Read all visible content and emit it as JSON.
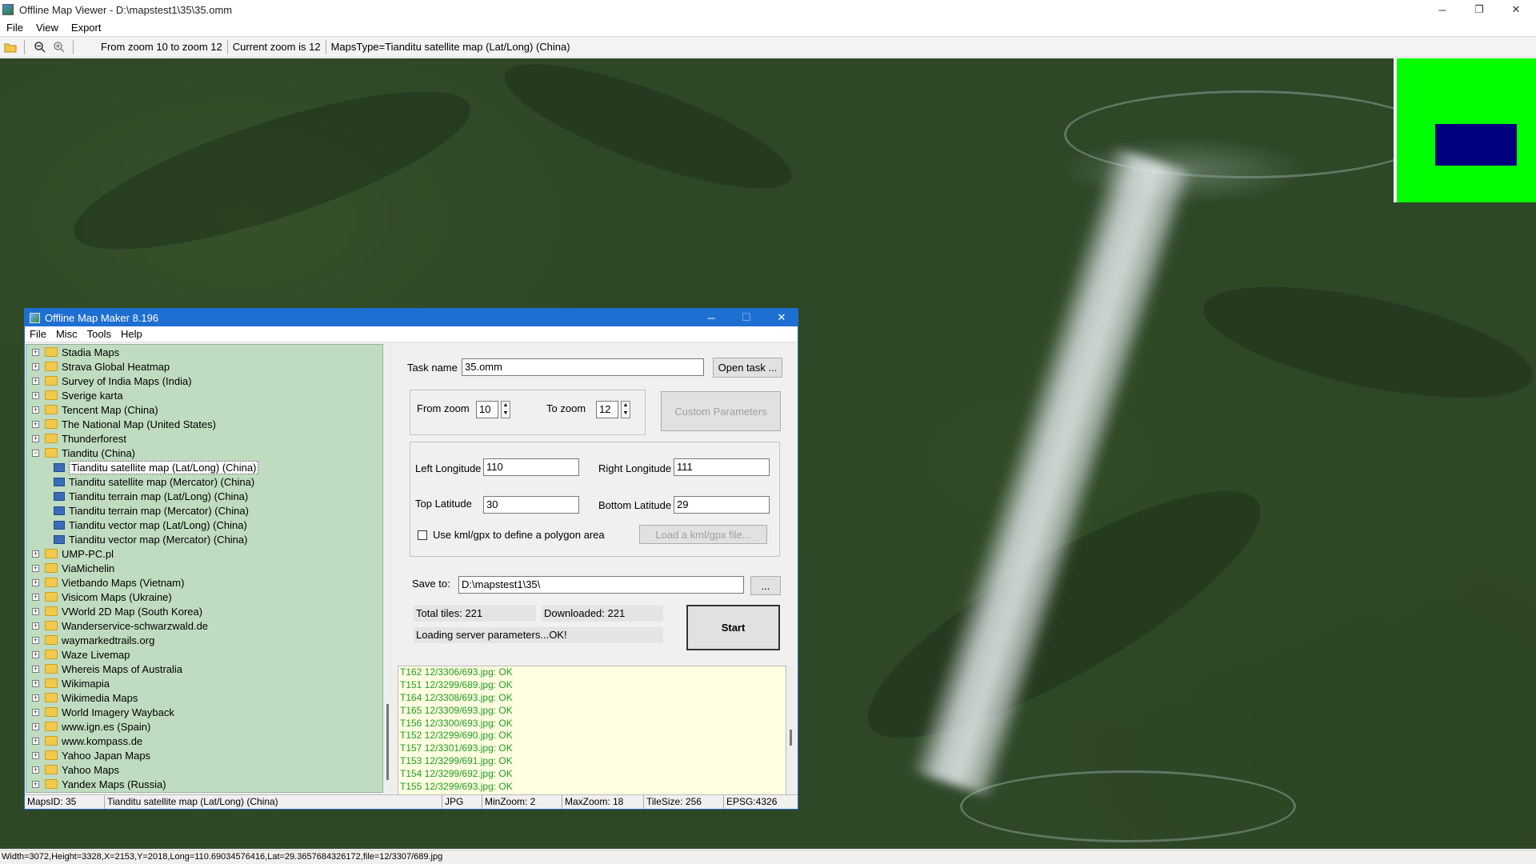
{
  "window": {
    "title": "Offline Map Viewer - D:\\mapstest1\\35\\35.omm",
    "minimize": "─",
    "restore": "❐",
    "close": "✕"
  },
  "menu": {
    "file": "File",
    "view": "View",
    "export": "Export"
  },
  "toolbar": {
    "zoom_range": "From zoom 10 to zoom 12",
    "current_zoom": "Current zoom is 12",
    "maps_type": "MapsType=Tianditu satellite map (Lat/Long) (China)"
  },
  "overview_colors": {
    "background": "#00ff00",
    "viewport": "#00007f"
  },
  "status_bar": "Width=3072,Height=3328,X=2153,Y=2018,Long=110.69034576416,Lat=29.3657684326172,file=12/3307/689.jpg",
  "dialog": {
    "title": "Offline Map Maker 8.196",
    "minimize": "─",
    "maximize": "☐",
    "close": "✕",
    "menu": {
      "file": "File",
      "misc": "Misc",
      "tools": "Tools",
      "help": "Help"
    },
    "tree": [
      {
        "label": "Stadia Maps",
        "type": "folder",
        "expander": "+"
      },
      {
        "label": "Strava Global Heatmap",
        "type": "folder",
        "expander": "+"
      },
      {
        "label": "Survey of India Maps (India)",
        "type": "folder",
        "expander": "+"
      },
      {
        "label": "Sverige karta",
        "type": "folder",
        "expander": "+"
      },
      {
        "label": "Tencent Map (China)",
        "type": "folder",
        "expander": "+"
      },
      {
        "label": "The National Map (United States)",
        "type": "folder",
        "expander": "+"
      },
      {
        "label": "Thunderforest",
        "type": "folder",
        "expander": "+"
      },
      {
        "label": "Tianditu (China)",
        "type": "folder",
        "expander": "−"
      },
      {
        "label": "Tianditu satellite map (Lat/Long) (China)",
        "type": "map",
        "selected": true
      },
      {
        "label": "Tianditu satellite map (Mercator) (China)",
        "type": "map"
      },
      {
        "label": "Tianditu terrain map (Lat/Long) (China)",
        "type": "map"
      },
      {
        "label": "Tianditu terrain map (Mercator) (China)",
        "type": "map"
      },
      {
        "label": "Tianditu vector map (Lat/Long) (China)",
        "type": "map"
      },
      {
        "label": "Tianditu vector map (Mercator) (China)",
        "type": "map"
      },
      {
        "label": "UMP-PC.pl",
        "type": "folder",
        "expander": "+"
      },
      {
        "label": "ViaMichelin",
        "type": "folder",
        "expander": "+"
      },
      {
        "label": "Vietbando Maps (Vietnam)",
        "type": "folder",
        "expander": "+"
      },
      {
        "label": "Visicom Maps (Ukraine)",
        "type": "folder",
        "expander": "+"
      },
      {
        "label": "VWorld 2D Map (South Korea)",
        "type": "folder",
        "expander": "+"
      },
      {
        "label": "Wanderservice-schwarzwald.de",
        "type": "folder",
        "expander": "+"
      },
      {
        "label": "waymarkedtrails.org",
        "type": "folder",
        "expander": "+"
      },
      {
        "label": "Waze Livemap",
        "type": "folder",
        "expander": "+"
      },
      {
        "label": "Whereis Maps of Australia",
        "type": "folder",
        "expander": "+"
      },
      {
        "label": "Wikimapia",
        "type": "folder",
        "expander": "+"
      },
      {
        "label": "Wikimedia Maps",
        "type": "folder",
        "expander": "+"
      },
      {
        "label": "World Imagery Wayback",
        "type": "folder",
        "expander": "+"
      },
      {
        "label": "www.ign.es (Spain)",
        "type": "folder",
        "expander": "+"
      },
      {
        "label": "www.kompass.de",
        "type": "folder",
        "expander": "+"
      },
      {
        "label": "Yahoo Japan Maps",
        "type": "folder",
        "expander": "+"
      },
      {
        "label": "Yahoo Maps",
        "type": "folder",
        "expander": "+"
      },
      {
        "label": "Yandex Maps (Russia)",
        "type": "folder",
        "expander": "+"
      }
    ],
    "task_name_label": "Task name",
    "task_name_value": "35.omm",
    "open_task": "Open task ...",
    "from_zoom_label": "From zoom",
    "from_zoom_value": "10",
    "to_zoom_label": "To zoom",
    "to_zoom_value": "12",
    "custom_params": "Custom Parameters",
    "left_lon_label": "Left Longitude",
    "left_lon_value": "110",
    "right_lon_label": "Right Longitude",
    "right_lon_value": "111",
    "top_lat_label": "Top Latitude",
    "top_lat_value": "30",
    "bottom_lat_label": "Bottom Latitude",
    "bottom_lat_value": "29",
    "use_kml_label": "Use kml/gpx to define a polygon area",
    "load_kml": "Load a kml/gpx file...",
    "save_to_label": "Save to:",
    "save_to_value": "D:\\mapstest1\\35\\",
    "browse": "...",
    "total_tiles": "Total tiles: 221",
    "downloaded": "Downloaded: 221",
    "loading_status": "Loading server parameters...OK!",
    "start": "Start",
    "log": [
      "T162 12/3306/693.jpg: OK",
      "T151 12/3299/689.jpg: OK",
      "T164 12/3308/693.jpg: OK",
      "T165 12/3309/693.jpg: OK",
      "T156 12/3300/693.jpg: OK",
      "T152 12/3299/690.jpg: OK",
      "T157 12/3301/693.jpg: OK",
      "T153 12/3299/691.jpg: OK",
      "T154 12/3299/692.jpg: OK",
      "T155 12/3299/693.jpg: OK"
    ],
    "status": {
      "maps_id": "MapsID: 35",
      "map_name": "Tianditu satellite map (Lat/Long) (China)",
      "format": "JPG",
      "min_zoom": "MinZoom: 2",
      "max_zoom": "MaxZoom: 18",
      "tile_size": "TileSize: 256",
      "epsg": "EPSG:4326"
    }
  }
}
